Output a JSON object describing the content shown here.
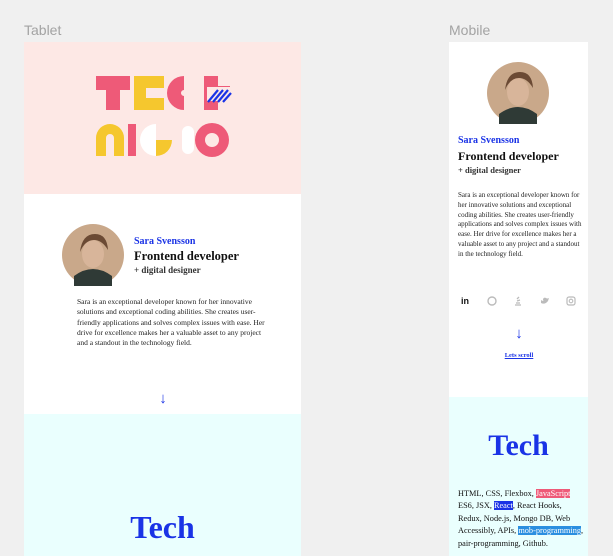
{
  "frames": {
    "tablet_label": "Tablet",
    "mobile_label": "Mobile"
  },
  "profile": {
    "name": "Sara Svensson",
    "role": "Frontend developer",
    "subrole": "+ digital designer",
    "bio": "Sara is an exceptional developer known for her innovative solutions and exceptional coding abilities. She creates user-friendly applications and solves complex issues with ease. Her drive for excellence makes her a valuable asset to any project and a standout in the technology field."
  },
  "scroll": {
    "arrow": "↓",
    "link": "Lets scroll"
  },
  "tech": {
    "title": "Tech",
    "stack_parts": [
      {
        "text": "HTML, CSS, Flexbox, ",
        "hl": ""
      },
      {
        "text": "JavaScript",
        "hl": "pink"
      },
      {
        "text": " ES6, JSX, ",
        "hl": ""
      },
      {
        "text": "React",
        "hl": "blue"
      },
      {
        "text": ", React Hooks, Redux, Node.js, Mongo DB, Web Accessibly, APIs, ",
        "hl": ""
      },
      {
        "text": "mob-programming",
        "hl": "lblue"
      },
      {
        "text": ", pair-programming, Github.",
        "hl": ""
      }
    ]
  },
  "social_icons": [
    "linkedin-icon",
    "github-icon",
    "stackoverflow-icon",
    "twitter-icon",
    "instagram-icon"
  ],
  "colors": {
    "accent_blue": "#1a33e6",
    "hero_bg": "#fde8e5",
    "tech_bg": "#eafffe",
    "pink": "#ee5a78",
    "yellow": "#f5c72e"
  }
}
